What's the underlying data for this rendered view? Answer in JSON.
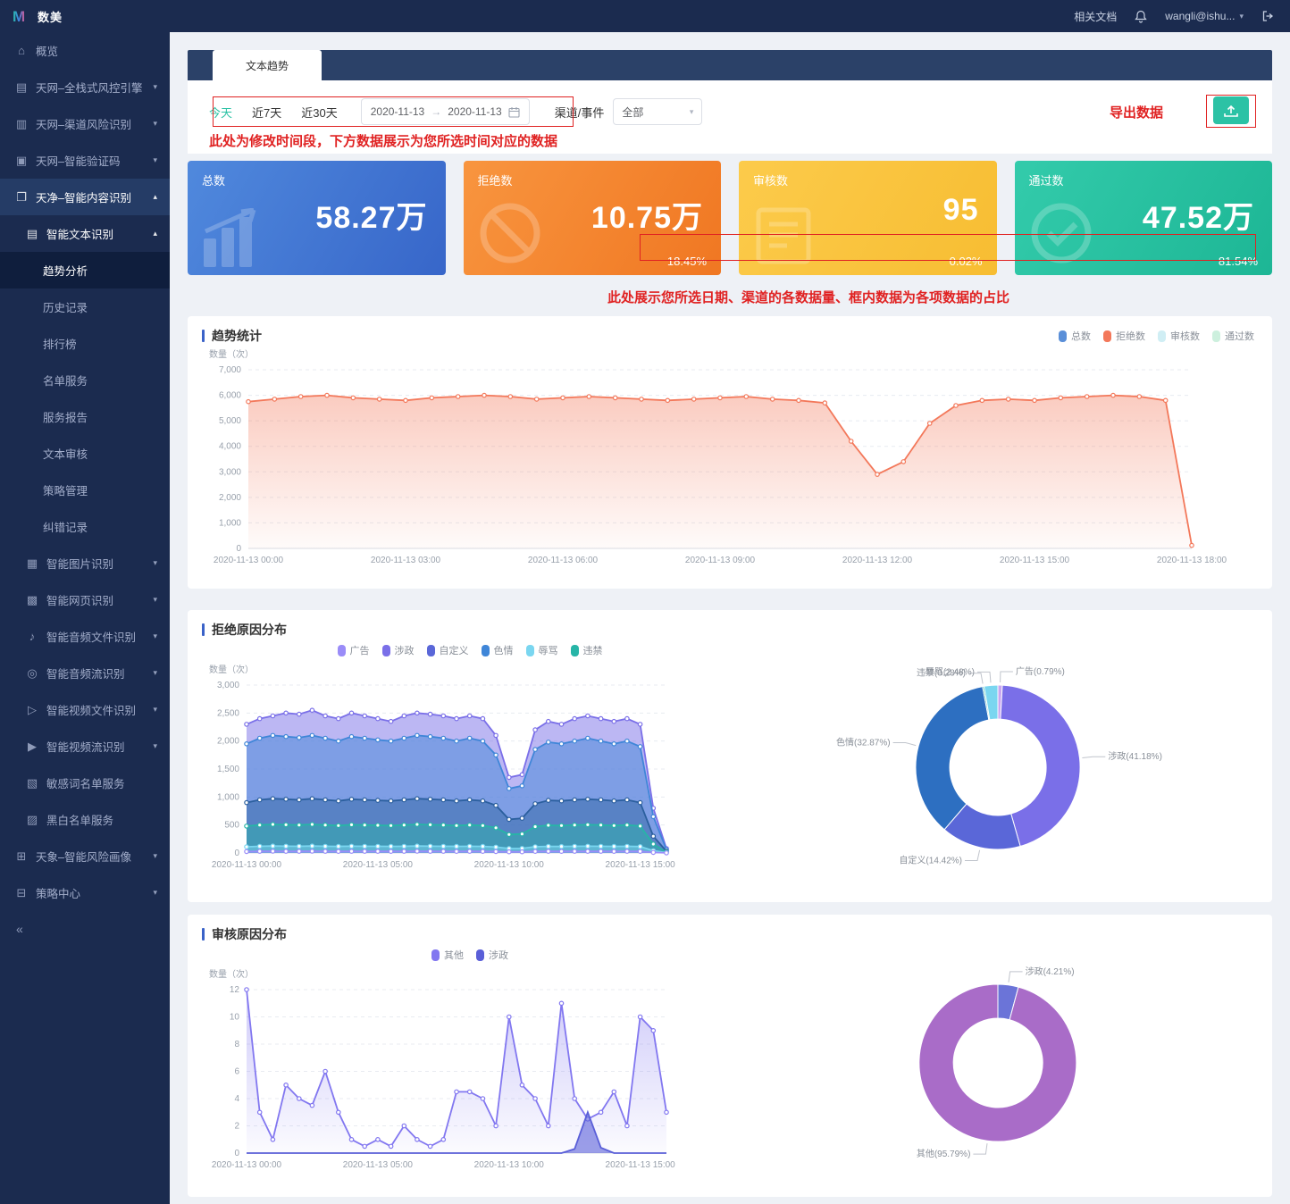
{
  "topbar": {
    "logo_text": "数美",
    "docs_link": "相关文档",
    "user_email": "wangli@ishu..."
  },
  "sidebar": {
    "items": [
      {
        "label": "概览",
        "level": 0,
        "icon": "overview-icon",
        "glyph": "⌂"
      },
      {
        "label": "天网–全栈式风控引擎",
        "level": 0,
        "icon": "risk-engine-icon",
        "glyph": "▤",
        "caret": "down"
      },
      {
        "label": "天网–渠道风险识别",
        "level": 0,
        "icon": "channel-risk-icon",
        "glyph": "▥",
        "caret": "down"
      },
      {
        "label": "天网–智能验证码",
        "level": 0,
        "icon": "captcha-icon",
        "glyph": "▣",
        "caret": "down"
      },
      {
        "label": "天净–智能内容识别",
        "level": 0,
        "icon": "content-recognition-icon",
        "glyph": "❐",
        "caret": "up",
        "state": "parent-open"
      },
      {
        "label": "智能文本识别",
        "level": 1,
        "icon": "text-recognition-icon",
        "glyph": "▤",
        "caret": "up",
        "state": "open"
      },
      {
        "label": "趋势分析",
        "level": 2,
        "state": "active"
      },
      {
        "label": "历史记录",
        "level": 2
      },
      {
        "label": "排行榜",
        "level": 2
      },
      {
        "label": "名单服务",
        "level": 2
      },
      {
        "label": "服务报告",
        "level": 2
      },
      {
        "label": "文本审核",
        "level": 2
      },
      {
        "label": "策略管理",
        "level": 2
      },
      {
        "label": "纠错记录",
        "level": 2
      },
      {
        "label": "智能图片识别",
        "level": 1,
        "icon": "image-recognition-icon",
        "glyph": "▦",
        "caret": "down"
      },
      {
        "label": "智能网页识别",
        "level": 1,
        "icon": "webpage-recognition-icon",
        "glyph": "▩",
        "caret": "down"
      },
      {
        "label": "智能音频文件识别",
        "level": 1,
        "icon": "audio-file-icon",
        "glyph": "♪",
        "caret": "down"
      },
      {
        "label": "智能音频流识别",
        "level": 1,
        "icon": "audio-stream-icon",
        "glyph": "◎",
        "caret": "down"
      },
      {
        "label": "智能视频文件识别",
        "level": 1,
        "icon": "video-file-icon",
        "glyph": "▷",
        "caret": "down"
      },
      {
        "label": "智能视频流识别",
        "level": 1,
        "icon": "video-stream-icon",
        "glyph": "▶",
        "caret": "down"
      },
      {
        "label": "敏感词名单服务",
        "level": 1,
        "icon": "sensitive-words-icon",
        "glyph": "▧"
      },
      {
        "label": "黑白名单服务",
        "level": 1,
        "icon": "blackwhite-list-icon",
        "glyph": "▨"
      },
      {
        "label": "天象–智能风险画像",
        "level": 0,
        "icon": "risk-profile-icon",
        "glyph": "⊞",
        "caret": "down"
      },
      {
        "label": "策略中心",
        "level": 0,
        "icon": "strategy-center-icon",
        "glyph": "⊟",
        "caret": "down"
      }
    ]
  },
  "tab": {
    "label": "文本趋势"
  },
  "filters": {
    "quick_options": [
      "今天",
      "近7天",
      "近30天"
    ],
    "active_quick": "今天",
    "date_from": "2020-11-13",
    "date_to": "2020-11-13",
    "channel_label": "渠道/事件",
    "channel_value": "全部"
  },
  "annotations": {
    "time_note": "此处为修改时间段，下方数据展示为您所选时间对应的数据",
    "export_label": "导出数据",
    "cards_note": "此处展示您所选日期、渠道的各数据量、框内数据为各项数据的占比"
  },
  "stat_cards": [
    {
      "label": "总数",
      "value": "58.27万",
      "percent": "",
      "color_from": "#5089dd",
      "color_to": "#3766c9",
      "icon": "bar-chart-icon"
    },
    {
      "label": "拒绝数",
      "value": "10.75万",
      "percent": "18.45%",
      "color_from": "#f8953f",
      "color_to": "#f07722",
      "icon": "ban-icon"
    },
    {
      "label": "审核数",
      "value": "95",
      "percent": "0.02%",
      "color_from": "#fccb4b",
      "color_to": "#f7bd32",
      "icon": "document-icon"
    },
    {
      "label": "通过数",
      "value": "47.52万",
      "percent": "81.54%",
      "color_from": "#33cbab",
      "color_to": "#1db695",
      "icon": "check-circle-icon"
    }
  ],
  "chart_data": [
    {
      "id": "trend",
      "type": "area",
      "title": "趋势统计",
      "ylabel": "数量（次）",
      "ylim": [
        0,
        7000
      ],
      "yticks": [
        0,
        1000,
        2000,
        3000,
        4000,
        5000,
        6000,
        7000
      ],
      "xtick_idx": [
        0,
        6,
        12,
        18,
        24,
        30,
        36
      ],
      "xtick_labels": [
        "2020-11-13 00:00",
        "2020-11-13 03:00",
        "2020-11-13 06:00",
        "2020-11-13 09:00",
        "2020-11-13 12:00",
        "2020-11-13 15:00",
        "2020-11-13 18:00"
      ],
      "legend": [
        {
          "label": "总数",
          "color": "#5a8fd8",
          "disabled": false
        },
        {
          "label": "拒绝数",
          "color": "#f3785a",
          "disabled": false
        },
        {
          "label": "审核数",
          "color": "#56c3d8",
          "disabled": true
        },
        {
          "label": "通过数",
          "color": "#4cc98a",
          "disabled": true
        }
      ],
      "series": [
        {
          "name": "拒绝数",
          "color": "#f3785a",
          "gradient": true,
          "markers": true,
          "values": [
            5750,
            5850,
            5950,
            6000,
            5900,
            5850,
            5800,
            5900,
            5950,
            6000,
            5950,
            5850,
            5900,
            5950,
            5900,
            5850,
            5800,
            5850,
            5900,
            5950,
            5850,
            5800,
            5700,
            4200,
            2900,
            3400,
            4900,
            5600,
            5800,
            5850,
            5800,
            5900,
            5950,
            6000,
            5950,
            5800,
            120
          ]
        }
      ]
    },
    {
      "id": "reject",
      "type": "area",
      "title": "拒绝原因分布",
      "ylabel": "数量（次）",
      "ylim": [
        0,
        3000
      ],
      "yticks": [
        0,
        500,
        1000,
        1500,
        2000,
        2500,
        3000
      ],
      "xtick_idx": [
        0,
        10,
        20,
        30
      ],
      "xtick_labels": [
        "2020-11-13 00:00",
        "2020-11-13 05:00",
        "2020-11-13 10:00",
        "2020-11-13 15:00"
      ],
      "legend": [
        {
          "label": "广告",
          "color": "#9a8cf8",
          "disabled": false
        },
        {
          "label": "涉政",
          "color": "#7a6fe8",
          "disabled": false
        },
        {
          "label": "自定义",
          "color": "#5a67d8",
          "disabled": false
        },
        {
          "label": "色情",
          "color": "#3f86d8",
          "disabled": false
        },
        {
          "label": "辱骂",
          "color": "#7ad6f0",
          "disabled": false
        },
        {
          "label": "违禁",
          "color": "#27b5a7",
          "disabled": false
        }
      ],
      "series": [
        {
          "name": "涉政",
          "color": "#7a6fe8",
          "fill": 0.5,
          "markers": true,
          "values": [
            2300,
            2400,
            2450,
            2500,
            2480,
            2550,
            2450,
            2400,
            2500,
            2450,
            2400,
            2350,
            2450,
            2500,
            2480,
            2450,
            2400,
            2450,
            2400,
            2100,
            1350,
            1400,
            2200,
            2350,
            2300,
            2400,
            2450,
            2400,
            2350,
            2400,
            2300,
            800,
            80
          ]
        },
        {
          "name": "色情",
          "color": "#3f86d8",
          "fill": 0.5,
          "markers": true,
          "values": [
            1950,
            2050,
            2100,
            2080,
            2060,
            2100,
            2050,
            2000,
            2080,
            2050,
            2020,
            2000,
            2050,
            2100,
            2080,
            2050,
            2000,
            2050,
            2000,
            1750,
            1150,
            1200,
            1850,
            1980,
            1950,
            2000,
            2050,
            2000,
            1950,
            2000,
            1900,
            650,
            60
          ]
        },
        {
          "name": "自定义",
          "color": "#2b5f9e",
          "fill": 0.45,
          "markers": true,
          "values": [
            900,
            950,
            970,
            960,
            950,
            970,
            950,
            930,
            960,
            950,
            940,
            930,
            950,
            970,
            960,
            950,
            930,
            950,
            930,
            850,
            600,
            620,
            880,
            940,
            930,
            950,
            960,
            950,
            930,
            950,
            900,
            300,
            30
          ]
        },
        {
          "name": "违禁",
          "color": "#27b5a7",
          "fill": 0.45,
          "markers": true,
          "values": [
            480,
            500,
            510,
            505,
            500,
            510,
            500,
            490,
            505,
            500,
            495,
            490,
            500,
            510,
            505,
            500,
            490,
            500,
            490,
            450,
            330,
            340,
            470,
            495,
            490,
            500,
            505,
            500,
            490,
            500,
            480,
            160,
            15
          ]
        },
        {
          "name": "辱骂",
          "color": "#7ad6f0",
          "fill": 0.5,
          "markers": true,
          "values": [
            110,
            120,
            125,
            122,
            120,
            125,
            120,
            118,
            122,
            120,
            119,
            118,
            120,
            125,
            122,
            120,
            118,
            120,
            118,
            105,
            80,
            82,
            112,
            118,
            117,
            120,
            122,
            120,
            118,
            120,
            115,
            40,
            5
          ]
        },
        {
          "name": "广告",
          "color": "#9a8cf8",
          "fill": 0.5,
          "markers": true,
          "values": [
            25,
            30,
            32,
            31,
            30,
            32,
            30,
            29,
            31,
            30,
            30,
            29,
            30,
            32,
            31,
            30,
            29,
            30,
            29,
            26,
            20,
            20,
            28,
            30,
            29,
            30,
            31,
            30,
            29,
            30,
            28,
            10,
            2
          ]
        }
      ]
    },
    {
      "id": "reject-donut",
      "type": "pie",
      "slices": [
        {
          "label": "广告",
          "pct": 0.79,
          "color": "#c9a6f0"
        },
        {
          "label": "涉政",
          "pct": 41.18,
          "color": "#7a6fe8"
        },
        {
          "label": "自定义",
          "pct": 14.42,
          "color": "#5a67d8"
        },
        {
          "label": "色情",
          "pct": 32.87,
          "color": "#2d6fc1"
        },
        {
          "label": "违禁",
          "pct": 0.28,
          "color": "#27b5a7"
        },
        {
          "label": "辱骂",
          "pct": 2.48,
          "color": "#7ad6f0"
        }
      ]
    },
    {
      "id": "review",
      "type": "area",
      "title": "审核原因分布",
      "ylabel": "数量（次）",
      "ylim": [
        0,
        12
      ],
      "yticks": [
        0,
        2,
        4,
        6,
        8,
        10,
        12
      ],
      "xtick_idx": [
        0,
        10,
        20,
        30
      ],
      "xtick_labels": [
        "2020-11-13 00:00",
        "2020-11-13 05:00",
        "2020-11-13 10:00",
        "2020-11-13 15:00"
      ],
      "legend": [
        {
          "label": "其他",
          "color": "#8277f0",
          "disabled": false
        },
        {
          "label": "涉政",
          "color": "#5a5fd8",
          "disabled": false
        }
      ],
      "series": [
        {
          "name": "其他",
          "color": "#8277f0",
          "gradient": true,
          "markers": true,
          "values": [
            12,
            3,
            1,
            5,
            4,
            3.5,
            6,
            3,
            1,
            0.5,
            1,
            0.5,
            2,
            1,
            0.5,
            1,
            4.5,
            4.5,
            4,
            2,
            10,
            5,
            4,
            2,
            11,
            4,
            2.5,
            3,
            4.5,
            2,
            10,
            9,
            3
          ]
        },
        {
          "name": "涉政",
          "color": "#5a5fd8",
          "fill": 0.6,
          "markers": false,
          "values": [
            0,
            0,
            0,
            0,
            0,
            0,
            0,
            0,
            0,
            0,
            0,
            0,
            0,
            0,
            0,
            0,
            0,
            0,
            0,
            0,
            0,
            0,
            0,
            0,
            0,
            0.3,
            3,
            0.4,
            0,
            0,
            0,
            0,
            0
          ]
        }
      ]
    },
    {
      "id": "review-donut",
      "type": "pie",
      "slices": [
        {
          "label": "涉政",
          "pct": 4.21,
          "color": "#6b74d8"
        },
        {
          "label": "其他",
          "pct": 95.79,
          "color": "#a96cc8"
        }
      ]
    }
  ]
}
